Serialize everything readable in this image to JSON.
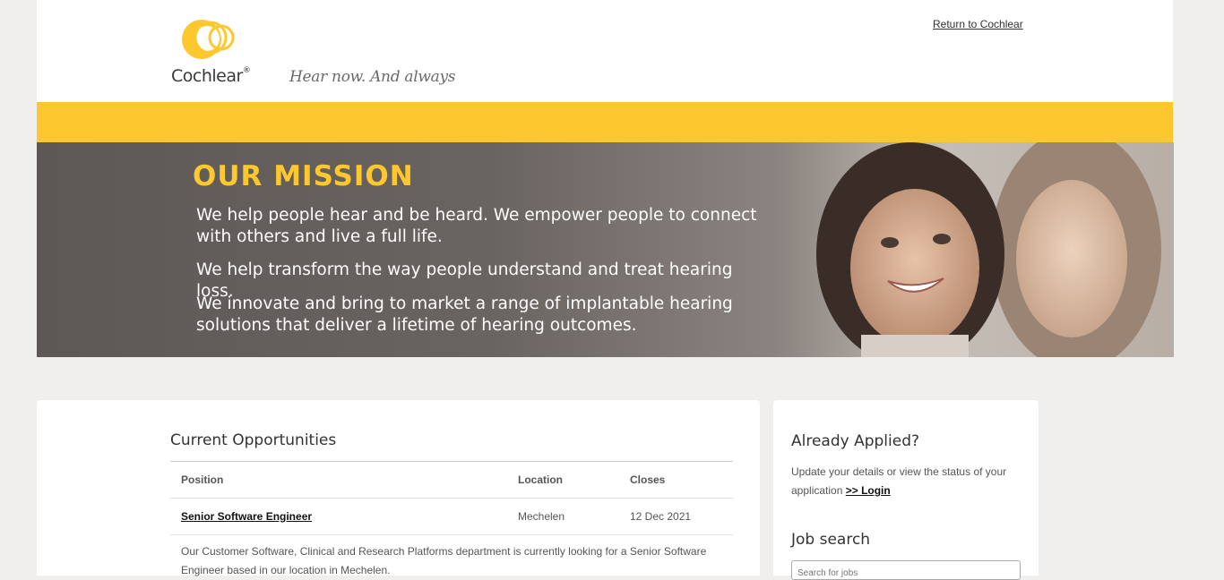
{
  "header": {
    "brand_name": "Cochlear",
    "brand_mark": "®",
    "tagline": "Hear now. And always",
    "return_link": "Return to Cochlear"
  },
  "hero": {
    "title": "OUR MISSION",
    "paragraphs": [
      "We help people hear and be heard. We empower people to connect with others and live a full life.",
      "We help transform the way people understand and treat hearing loss.",
      "We innovate and bring to market a range of implantable hearing solutions that deliver a lifetime of hearing outcomes."
    ]
  },
  "opportunities": {
    "title": "Current Opportunities",
    "columns": [
      "Position",
      "Location",
      "Closes"
    ],
    "jobs": [
      {
        "position": "Senior Software Engineer",
        "location": "Mechelen",
        "closes": "12 Dec 2021"
      }
    ],
    "description": "Our Customer Software, Clinical and Research Platforms department is currently looking for a Senior Software Engineer based in our location in Mechelen."
  },
  "sidebar": {
    "applied_title": "Already Applied?",
    "applied_text": "Update your details or view the status of your application",
    "login_link": ">> Login",
    "search_title": "Job search",
    "search_placeholder": "Search for jobs"
  },
  "colors": {
    "brand_yellow": "#fdc82f",
    "background": "#f0efed"
  }
}
